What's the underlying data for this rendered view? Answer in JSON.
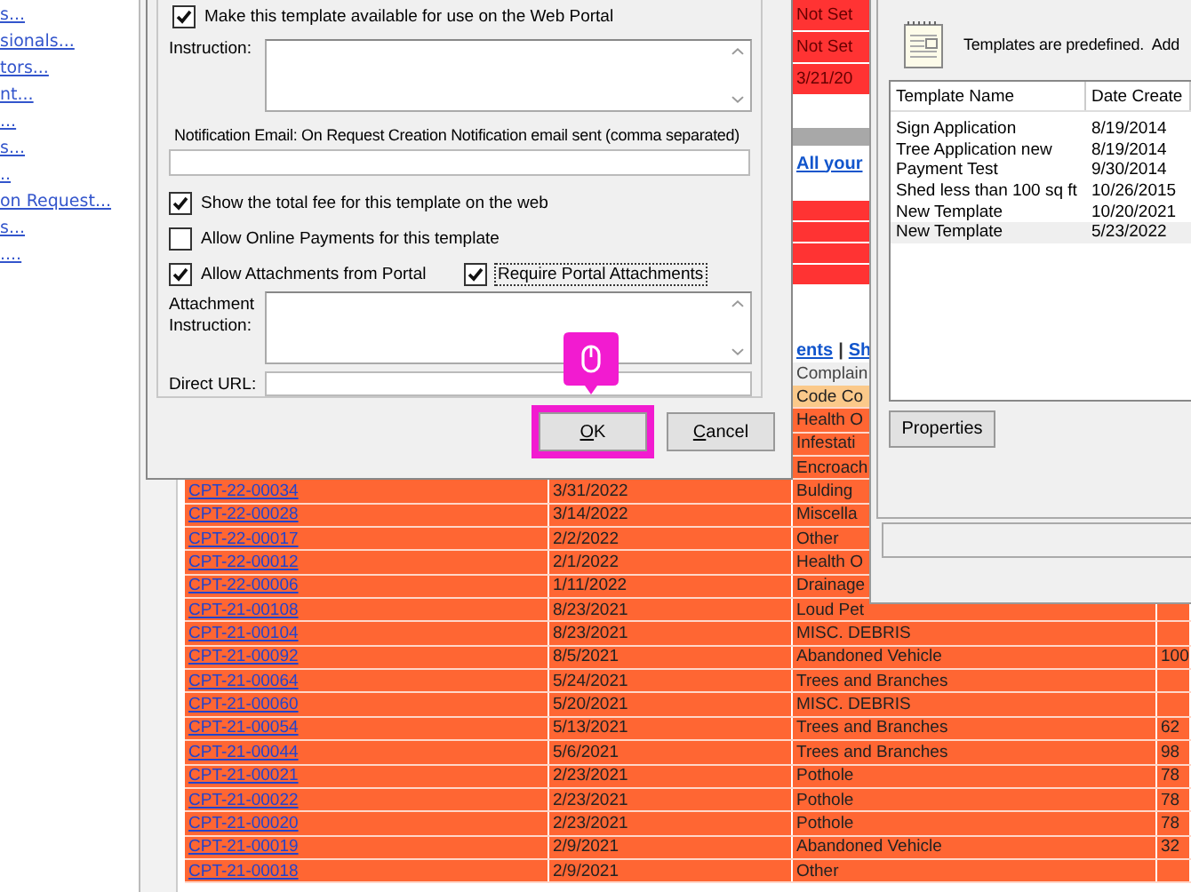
{
  "sidebar": {
    "links": [
      "s...",
      "sionals...",
      "tors...",
      "nt...",
      "...",
      "s...",
      "..",
      "on Request...",
      "s...",
      "...."
    ]
  },
  "page": {
    "upper_rows": [
      {
        "text": "Not Set",
        "color": "#ff3333"
      },
      {
        "text": "Not Set",
        "color": "#ff3333"
      },
      {
        "text": "3/21/20",
        "color": "#ff3333"
      }
    ],
    "all_link": "All your",
    "middle_rows": [
      {
        "color": "#ff3333"
      },
      {
        "color": "#ff3333"
      },
      {
        "color": "#ff3333"
      },
      {
        "color": "#ff3333"
      }
    ],
    "links": [
      "ents",
      "Sh"
    ],
    "link_separator": "|",
    "table": {
      "columns": [
        "Complain"
      ],
      "rows": [
        {
          "complaint": "Code Co",
          "color": "#fbc98a"
        },
        {
          "complaint": "Health O",
          "color": "#ff6633"
        },
        {
          "complaint": "Infestati",
          "color": "#ff6633"
        },
        {
          "complaint": "Encroach",
          "color": "#ff6633"
        },
        {
          "id": "CPT-22-00034",
          "date": "3/31/2022",
          "complaint": "Bulding",
          "color": "#ff6633"
        },
        {
          "id": "CPT-22-00028",
          "date": "3/14/2022",
          "complaint": "Miscella",
          "color": "#ff6633"
        },
        {
          "id": "CPT-22-00017",
          "date": "2/2/2022",
          "complaint": "Other",
          "color": "#ff6633"
        },
        {
          "id": "CPT-22-00012",
          "date": "2/1/2022",
          "complaint": "Health O",
          "color": "#ff6633"
        },
        {
          "id": "CPT-22-00006",
          "date": "1/11/2022",
          "complaint": "Drainage",
          "color": "#ff6633"
        },
        {
          "id": "CPT-21-00108",
          "date": "8/23/2021",
          "complaint": "Loud Pet",
          "color": "#ff6633"
        },
        {
          "id": "CPT-21-00104",
          "date": "8/23/2021",
          "complaint": "MISC. DEBRIS",
          "color": "#ff6633"
        },
        {
          "id": "CPT-21-00092",
          "date": "8/5/2021",
          "complaint": "Abandoned Vehicle",
          "column_4": "100",
          "color": "#ff6633"
        },
        {
          "id": "CPT-21-00064",
          "date": "5/24/2021",
          "complaint": "Trees and Branches",
          "color": "#ff6633"
        },
        {
          "id": "CPT-21-00060",
          "date": "5/20/2021",
          "complaint": "MISC. DEBRIS",
          "color": "#ff6633"
        },
        {
          "id": "CPT-21-00054",
          "date": "5/13/2021",
          "complaint": "Trees and Branches",
          "column_4": "62",
          "color": "#ff6633"
        },
        {
          "id": "CPT-21-00044",
          "date": "5/6/2021",
          "complaint": "Trees and Branches",
          "column_4": "98",
          "color": "#ff6633"
        },
        {
          "id": "CPT-21-00021",
          "date": "2/23/2021",
          "complaint": "Pothole",
          "column_4": "78",
          "color": "#ff6633"
        },
        {
          "id": "CPT-21-00022",
          "date": "2/23/2021",
          "complaint": "Pothole",
          "column_4": "78",
          "color": "#ff6633"
        },
        {
          "id": "CPT-21-00020",
          "date": "2/23/2021",
          "complaint": "Pothole",
          "column_4": "78",
          "color": "#ff6633"
        },
        {
          "id": "CPT-21-00019",
          "date": "2/9/2021",
          "complaint": "Abandoned Vehicle",
          "column_4": "32",
          "color": "#ff6633"
        },
        {
          "id": "CPT-21-00018",
          "date": "2/9/2021",
          "complaint": "Other",
          "color": "#ff6633"
        }
      ]
    }
  },
  "template_dialog": {
    "web_portal": {
      "label": "Make this template available for use on the Web Portal",
      "checked": true
    },
    "instruction_label": "Instruction:",
    "notification_label": "Notification Email: On Request Creation Notification email sent (comma separated)",
    "options": [
      {
        "label": "Show the total fee for this template on the web",
        "checked": true
      },
      {
        "label": "Allow Online Payments for this template",
        "checked": false
      }
    ],
    "attachments": [
      {
        "label": "Allow Attachments from Portal",
        "checked": true,
        "focused": false
      },
      {
        "label": "Require Portal Attachments",
        "checked": true,
        "focused": true
      }
    ],
    "attachment_instruction_label": "Attachment Instruction:",
    "direct_url_label": "Direct URL:",
    "buttons": [
      {
        "label": "OK",
        "highlighted": true
      },
      {
        "label": "Cancel",
        "highlighted": false
      }
    ]
  },
  "templates_dialog": {
    "message": "Templates are predefined.  Add",
    "columns": [
      "Template Name",
      "Date Create"
    ],
    "rows": [
      {
        "name": "Sign Application",
        "date": "8/19/2014",
        "selected": false
      },
      {
        "name": "Tree Application new",
        "date": "8/19/2014",
        "selected": false
      },
      {
        "name": "Payment Test",
        "date": "9/30/2014",
        "selected": false
      },
      {
        "name": "Shed less than 100 sq ft",
        "date": "10/26/2015",
        "selected": false
      },
      {
        "name": "New Template",
        "date": "10/20/2021",
        "selected": false
      },
      {
        "name": "New Template",
        "date": "5/23/2022",
        "selected": true
      }
    ],
    "properties_button": "Properties"
  }
}
